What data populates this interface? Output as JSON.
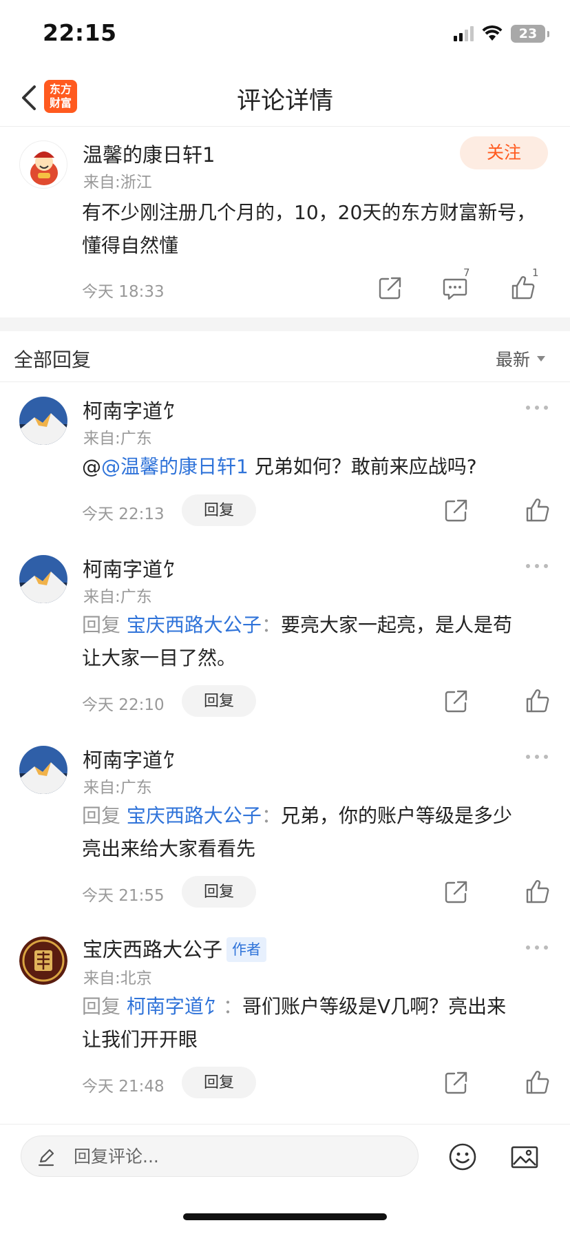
{
  "status_bar": {
    "time": "22:15",
    "battery": "23",
    "icons": [
      "signal-icon",
      "wifi-icon",
      "battery-icon"
    ]
  },
  "nav": {
    "title": "评论详情",
    "logo_line1": "东方",
    "logo_line2": "财富",
    "icons": [
      "back-arrow-icon"
    ]
  },
  "main_comment": {
    "username": "温馨的康日轩1",
    "from": "来自:浙江",
    "text_line1": "有不少刚注册几个月的，10，20天的东方财富新号，",
    "text_line2": "懂得自然懂",
    "time": "今天 18:33",
    "follow_label": "关注",
    "comment_count": "7",
    "like_count": "1",
    "icons": [
      "share-icon",
      "comment-icon",
      "thumbs-up-icon"
    ]
  },
  "section": {
    "title": "全部回复",
    "sort_label": "最新"
  },
  "replies": [
    {
      "username": "柯南字道饣",
      "from": "来自:广东",
      "prefix": "@",
      "mention": "@温馨的康日轩1",
      "text": " 兄弟如何？敢前来应战吗?",
      "time": "今天 22:13",
      "reply_label": "回复"
    },
    {
      "username": "柯南字道饣",
      "from": "来自:广东",
      "reply_word": "回复",
      "mention": "宝庆西路大公子",
      "colon": "：",
      "text_line1": "要亮大家一起亮，是人是苟",
      "text_line2": "让大家一目了然。",
      "time": "今天 22:10",
      "reply_label": "回复"
    },
    {
      "username": "柯南字道饣",
      "from": "来自:广东",
      "reply_word": "回复",
      "mention": "宝庆西路大公子",
      "colon": "：",
      "text_line1": "兄弟，你的账户等级是多少",
      "text_line2": "亮出来给大家看看先",
      "time": "今天 21:55",
      "reply_label": "回复"
    },
    {
      "username": "宝庆西路大公子",
      "author_tag": "作者",
      "from": "来自:北京",
      "reply_word": "回复",
      "mention": "柯南字道饣",
      "colon": "：",
      "text_line1": "哥们账户等级是Ⅴ几啊？亮出来",
      "text_line2": "让我们开开眼",
      "time": "今天 21:48",
      "reply_label": "回复"
    }
  ],
  "bottom_bar": {
    "placeholder": "回复评论...",
    "icons": [
      "pencil-icon",
      "emoji-icon",
      "image-icon"
    ]
  },
  "colors": {
    "accent_orange": "#ff5a1f",
    "link_blue": "#2f73d9",
    "muted_gray": "#999999"
  }
}
